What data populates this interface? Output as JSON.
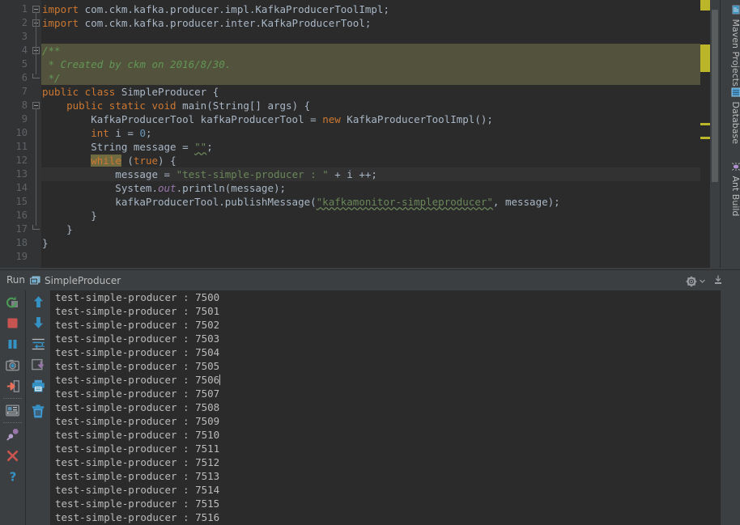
{
  "editor": {
    "lines": [
      {
        "no": 1,
        "tokens": [
          {
            "t": "import",
            "c": "k"
          },
          {
            "t": " com.ckm.kafka.producer.impl.KafkaProducerToolImpl;",
            "c": ""
          }
        ]
      },
      {
        "no": 2,
        "tokens": [
          {
            "t": "import",
            "c": "k"
          },
          {
            "t": " com.ckm.kafka.producer.inter.KafkaProducerTool;",
            "c": ""
          }
        ]
      },
      {
        "no": 3,
        "tokens": []
      },
      {
        "no": 4,
        "style": "doc",
        "tokens": [
          {
            "t": "/**",
            "c": "cm"
          }
        ]
      },
      {
        "no": 5,
        "style": "doc",
        "tokens": [
          {
            "t": " * Created by ckm on 2016/8/30.",
            "c": "cm"
          }
        ]
      },
      {
        "no": 6,
        "style": "doc",
        "tokens": [
          {
            "t": " */",
            "c": "cm"
          }
        ]
      },
      {
        "no": 7,
        "tokens": [
          {
            "t": "public class ",
            "c": "k"
          },
          {
            "t": "SimpleProducer {",
            "c": ""
          }
        ]
      },
      {
        "no": 8,
        "tokens": [
          {
            "t": "    ",
            "c": ""
          },
          {
            "t": "public static void ",
            "c": "k"
          },
          {
            "t": "main(String[] args) {",
            "c": ""
          }
        ]
      },
      {
        "no": 9,
        "tokens": [
          {
            "t": "        KafkaProducerTool kafkaProducerTool = ",
            "c": ""
          },
          {
            "t": "new ",
            "c": "k"
          },
          {
            "t": "KafkaProducerToolImpl();",
            "c": ""
          }
        ]
      },
      {
        "no": 10,
        "tokens": [
          {
            "t": "        ",
            "c": ""
          },
          {
            "t": "int ",
            "c": "k"
          },
          {
            "t": "i = ",
            "c": ""
          },
          {
            "t": "0",
            "c": "n"
          },
          {
            "t": ";",
            "c": ""
          }
        ]
      },
      {
        "no": 11,
        "tokens": [
          {
            "t": "        String message = ",
            "c": ""
          },
          {
            "t": "\"\"",
            "c": "sq"
          },
          {
            "t": ";",
            "c": ""
          }
        ]
      },
      {
        "no": 12,
        "tokens": [
          {
            "t": "        ",
            "c": ""
          },
          {
            "t": "while",
            "c": "hl"
          },
          {
            "t": " (",
            "c": ""
          },
          {
            "t": "true",
            "c": "k"
          },
          {
            "t": ") {",
            "c": ""
          }
        ]
      },
      {
        "no": 13,
        "style": "cur",
        "tokens": [
          {
            "t": "            message = ",
            "c": ""
          },
          {
            "t": "\"test-simple-producer : \"",
            "c": "s"
          },
          {
            "t": " + i ++;",
            "c": ""
          }
        ]
      },
      {
        "no": 14,
        "tokens": [
          {
            "t": "            System.",
            "c": ""
          },
          {
            "t": "out",
            "c": "f"
          },
          {
            "t": ".println(message);",
            "c": ""
          }
        ]
      },
      {
        "no": 15,
        "tokens": [
          {
            "t": "            kafkaProducerTool.publishMessage(",
            "c": ""
          },
          {
            "t": "\"kafkamonitor-simpleproducer\"",
            "c": "sq"
          },
          {
            "t": ", message);",
            "c": ""
          }
        ]
      },
      {
        "no": 16,
        "tokens": [
          {
            "t": "        }",
            "c": ""
          }
        ]
      },
      {
        "no": 17,
        "tokens": [
          {
            "t": "    }",
            "c": ""
          }
        ]
      },
      {
        "no": 18,
        "tokens": [
          {
            "t": "}",
            "c": ""
          }
        ]
      },
      {
        "no": 19,
        "tokens": []
      }
    ],
    "fold_lines": [
      1,
      2,
      4,
      8
    ],
    "fold_ends": [
      6,
      17
    ],
    "colors": {
      "background": "#2b2b2b",
      "gutter": "#313335",
      "keyword": "#cc7832",
      "string": "#6a8759",
      "comment": "#629755",
      "number": "#6897bb",
      "field": "#9876aa",
      "text": "#a9b7c6",
      "doc_highlight": "#53523d",
      "occurrence_highlight": "#6f6a3f",
      "marker_stripe": "#bbb529"
    }
  },
  "right_tool_strip": {
    "tabs": [
      {
        "label": "Maven Projects",
        "icon": "maven-icon"
      },
      {
        "label": "Database",
        "icon": "database-icon"
      },
      {
        "label": "Ant Build",
        "icon": "ant-icon"
      }
    ]
  },
  "run_panel": {
    "title": "Run",
    "tab_label": "SimpleProducer",
    "tab_icon": "run-configuration-icon",
    "header_actions": [
      {
        "name": "settings-button",
        "icon": "gear-icon",
        "has_dropdown": true
      },
      {
        "name": "hide-button",
        "icon": "hide-icon"
      }
    ],
    "toolbar_left": [
      {
        "name": "rerun-button",
        "icon": "rerun-icon",
        "color": "#499C54"
      },
      {
        "name": "stop-button",
        "icon": "stop-icon",
        "color": "#C75450"
      },
      {
        "name": "pause-button",
        "icon": "pause-icon",
        "color": "#3592C4"
      },
      {
        "name": "dump-threads-button",
        "icon": "camera-icon",
        "color": "#7E8287"
      },
      {
        "name": "exit-button",
        "icon": "exit-icon",
        "color": "#C75450"
      },
      {
        "name": "console-view-button",
        "icon": "console-icon",
        "color": "#7E8287"
      },
      {
        "name": "pin-tab-button",
        "icon": "pin-icon",
        "color": "#9876AA"
      },
      {
        "name": "close-button",
        "icon": "close-icon",
        "color": "#C75450"
      },
      {
        "name": "help-button",
        "icon": "help-icon",
        "color": "#3592C4"
      }
    ],
    "toolbar_right": [
      {
        "name": "scroll-up-button",
        "icon": "arrow-up-icon",
        "color": "#3592C4"
      },
      {
        "name": "scroll-down-button",
        "icon": "arrow-down-icon",
        "color": "#3592C4"
      },
      {
        "name": "soft-wrap-button",
        "icon": "soft-wrap-icon",
        "color": "#3592C4"
      },
      {
        "name": "scroll-to-end-button",
        "icon": "scroll-end-icon",
        "color": "#9876AA"
      },
      {
        "name": "print-button",
        "icon": "print-icon",
        "color": "#3592C4"
      },
      {
        "name": "clear-all-button",
        "icon": "trash-icon",
        "color": "#3592C4"
      }
    ],
    "console_output": [
      "test-simple-producer : 7500",
      "test-simple-producer : 7501",
      "test-simple-producer : 7502",
      "test-simple-producer : 7503",
      "test-simple-producer : 7504",
      "test-simple-producer : 7505",
      "test-simple-producer : 7506",
      "test-simple-producer : 7507",
      "test-simple-producer : 7508",
      "test-simple-producer : 7509",
      "test-simple-producer : 7510",
      "test-simple-producer : 7511",
      "test-simple-producer : 7512",
      "test-simple-producer : 7513",
      "test-simple-producer : 7514",
      "test-simple-producer : 7515",
      "test-simple-producer : 7516"
    ],
    "caret_line_index": 6
  }
}
